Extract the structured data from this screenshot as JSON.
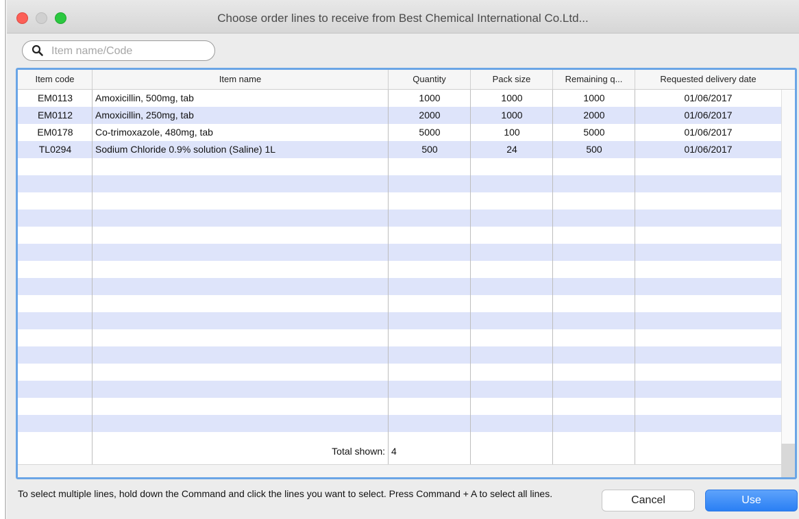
{
  "window": {
    "title": "Choose order lines to receive from Best Chemical International Co.Ltd..."
  },
  "search": {
    "placeholder": "Item name/Code",
    "value": ""
  },
  "table": {
    "columns": [
      "Item code",
      "Item name",
      "Quantity",
      "Pack size",
      "Remaining q...",
      "Requested delivery date"
    ],
    "rows": [
      {
        "code": "EM0113",
        "name": "Amoxicillin, 500mg, tab",
        "quantity": "1000",
        "pack_size": "1000",
        "remaining": "1000",
        "delivery_date": "01/06/2017"
      },
      {
        "code": "EM0112",
        "name": "Amoxicillin, 250mg, tab",
        "quantity": "2000",
        "pack_size": "1000",
        "remaining": "2000",
        "delivery_date": "01/06/2017"
      },
      {
        "code": "EM0178",
        "name": "Co-trimoxazole, 480mg, tab",
        "quantity": "5000",
        "pack_size": "100",
        "remaining": "5000",
        "delivery_date": "01/06/2017"
      },
      {
        "code": "TL0294",
        "name": "Sodium Chloride 0.9% solution (Saline) 1L",
        "quantity": "500",
        "pack_size": "24",
        "remaining": "500",
        "delivery_date": "01/06/2017"
      }
    ],
    "total_label": "Total shown:",
    "total_value": "4"
  },
  "footer": {
    "hint": "To select multiple lines, hold down the Command and click the lines you want to select. Press Command + A to select all lines.",
    "cancel_label": "Cancel",
    "use_label": "Use"
  },
  "colors": {
    "row_alt": "#dee4fa",
    "focus_border": "#6aa5e6",
    "primary_button": "#2a7ff4"
  }
}
